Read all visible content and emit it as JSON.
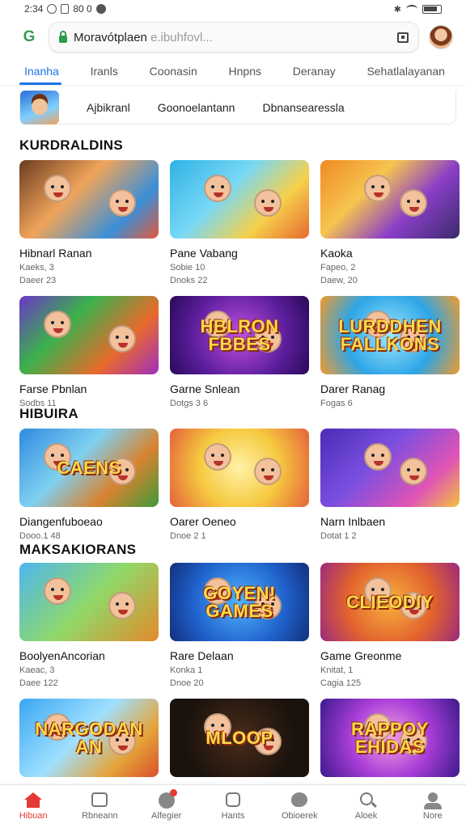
{
  "status_bar": {
    "time": "2:34",
    "extra": "80 0"
  },
  "browser": {
    "url_main": "Moravótplaen",
    "url_sub": "e.ibuhfovl...",
    "logo": "G"
  },
  "tabs": [
    "Inanha",
    "Iranls",
    "Coonasin",
    "Hnpns",
    "Deranay",
    "Sehatlalayanan"
  ],
  "category_strip": {
    "items": [
      "Ajbikranl",
      "Goonoelantann",
      "Dbnansearessla"
    ]
  },
  "sections": [
    {
      "title": "KURDRALDINS",
      "cards": [
        {
          "title": "Hibnarl Ranan",
          "meta1": "Kaeks, 3",
          "meta2": "Daeer 23",
          "thumb_text": "",
          "bg": "linear-gradient(135deg,#6b3b1f,#f0a45a 40%,#3b8fd9 75%,#e2593a)"
        },
        {
          "title": "Pane Vabang",
          "meta1": "Sobie 10",
          "meta2": "Dnoks 22",
          "thumb_text": "",
          "bg": "linear-gradient(135deg,#2fb2e6,#78d8f5 40%,#f6d14c 70%,#e6692f)"
        },
        {
          "title": "Kaoka",
          "meta1": "Fapeo, 2",
          "meta2": "Daew, 20",
          "thumb_text": "",
          "bg": "linear-gradient(135deg,#f08a23,#f6c450 35%,#8a3fc7 65%,#3a2a6c)"
        }
      ]
    },
    {
      "title": "",
      "cards": [
        {
          "title": "Farse Pbnlan",
          "meta1": "Sodbs 11",
          "meta2": "",
          "thumb_text": "",
          "bg": "linear-gradient(135deg,#6a36c8,#3bb14b 35%,#e86a2c 70%,#a12ec0)"
        },
        {
          "title": "Garne Snlean",
          "meta1": "Dotgs 3 6",
          "meta2": "",
          "thumb_text": "HBLRON FBBES",
          "bg": "radial-gradient(circle at 50% 50%,#c04fe0,#5a1d9b 60%,#2a0a58)"
        },
        {
          "title": "Darer Ranag",
          "meta1": "Fogas 6",
          "meta2": "",
          "thumb_text": "LURDDHEN FALLKONS",
          "bg": "radial-gradient(circle at 50% 50%,#9ce7ff,#2ea5e6 55%,#f29b2c)"
        }
      ]
    },
    {
      "title": "HIBUIRA",
      "cards": [
        {
          "title": "Diangenfuboeao",
          "meta1": "Dooo.1 48",
          "meta2": "",
          "thumb_text": "CAENS",
          "bg": "linear-gradient(135deg,#2f8ae0,#7fd0f0 40%,#d9822f 70%,#3f9a3a)"
        },
        {
          "title": "Oarer Oeneo",
          "meta1": "Dnoe 2 1",
          "meta2": "",
          "thumb_text": "",
          "bg": "radial-gradient(circle at 50% 50%,#fff2a8,#f6c93f 50%,#e4623a)"
        },
        {
          "title": "Narn Inlbaen",
          "meta1": "Dotat 1 2",
          "meta2": "",
          "thumb_text": "",
          "bg": "linear-gradient(135deg,#4b2bb5,#7a4fe0 40%,#e054b5 75%,#f2c23c)"
        }
      ]
    },
    {
      "title": "MAKSAKIORANS",
      "cards": [
        {
          "title": "BoolyenAncorian",
          "meta1": "Kaeac, 3",
          "meta2": "Daee 122",
          "thumb_text": "",
          "bg": "linear-gradient(135deg,#4db6f0,#8fd96a 50%,#e48b2a)"
        },
        {
          "title": "Rare Delaan",
          "meta1": "Konka 1",
          "meta2": "Dnoe 20",
          "thumb_text": "GOYEN! GAMES",
          "bg": "radial-gradient(circle at 50% 50%,#4fb3ff,#1e5fc9 60%,#132f7a)"
        },
        {
          "title": "Game Greonme",
          "meta1": "Knitat, 1",
          "meta2": "Cagia 125",
          "thumb_text": "CLIEODIY",
          "bg": "radial-gradient(circle at 50% 50%,#f7b23d,#e2622e 55%,#9b2a7d)"
        }
      ]
    },
    {
      "title": "",
      "cards": [
        {
          "title": "",
          "meta1": "",
          "meta2": "",
          "thumb_text": "NARGODAN AN",
          "bg": "linear-gradient(135deg,#3aa6f2,#9fe0ff 45%,#e6a43a 75%,#d94f2a)"
        },
        {
          "title": "",
          "meta1": "",
          "meta2": "",
          "thumb_text": "MLOOP",
          "bg": "radial-gradient(circle at 50% 50%,#4a2c1a,#1a120c 70%)"
        },
        {
          "title": "",
          "meta1": "",
          "meta2": "",
          "thumb_text": "RAPPOY EHIDAS",
          "bg": "radial-gradient(circle at 50% 50%,#f5a0e0,#a83dd8 50%,#3c1a8c)"
        }
      ]
    }
  ],
  "bottom_nav": [
    "Hibuan",
    "Rbneann",
    "Alfegier",
    "Hants",
    "Obioerek",
    "Aloek",
    "Nore"
  ]
}
